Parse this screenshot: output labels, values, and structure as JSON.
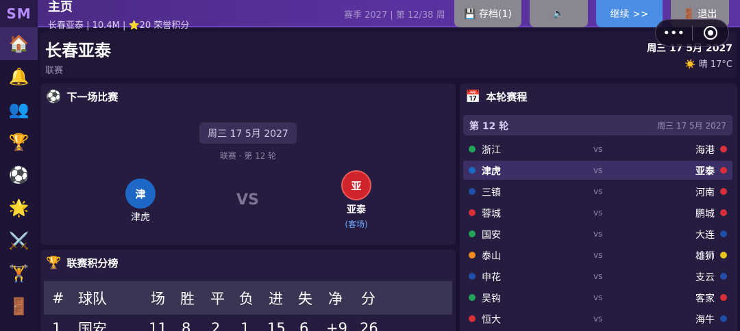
{
  "app": {
    "logo": "SM"
  },
  "topbar": {
    "title": "主页",
    "subtitle": "长春亚泰 | 10.4M | ",
    "star": "⭐",
    "honor": "20 荣誉积分",
    "season": "赛季 2027 | 第 12/38 周",
    "save_label": "💾 存档(1)",
    "volume_label": "🔈",
    "continue_label": "继续  >>",
    "exit_label": "🚪 退出"
  },
  "capsule": {
    "more_label": "•••"
  },
  "sidebar": {
    "items": [
      {
        "name": "home",
        "icon": "🏠"
      },
      {
        "name": "notifications",
        "icon": "🔔"
      },
      {
        "name": "squad",
        "icon": "👥"
      },
      {
        "name": "trophies",
        "icon": "🏆"
      },
      {
        "name": "matches",
        "icon": "⚽"
      },
      {
        "name": "highlights",
        "icon": "🌟"
      },
      {
        "name": "battle",
        "icon": "⚔️"
      },
      {
        "name": "training",
        "icon": "🏋️"
      },
      {
        "name": "exit",
        "icon": "🚪"
      }
    ]
  },
  "header": {
    "team": "长春亚泰",
    "competition": "联赛",
    "date": "周三 17 5月 2027",
    "weather_icon": "☀️",
    "weather": "晴 17°C"
  },
  "next_match": {
    "title": "下一场比赛",
    "icon": "⚽",
    "date": "周三 17 5月 2027",
    "info": "联赛  ·  第 12 轮",
    "home_crest": "津",
    "home_name": "津虎",
    "vs": "VS",
    "away_crest": "亚",
    "away_name": "亚泰",
    "away_note": "(客场)"
  },
  "league_table": {
    "title": "联赛积分榜",
    "icon": "🏆",
    "headers": [
      "#",
      "球队",
      "场",
      "胜",
      "平",
      "负",
      "进",
      "失",
      "净",
      "分"
    ],
    "rows": [
      [
        "1",
        "国安",
        "11",
        "8",
        "2",
        "1",
        "15",
        "6",
        "+9",
        "26"
      ]
    ]
  },
  "round": {
    "title": "本轮赛程",
    "icon": "📅",
    "round_label": "第 12 轮",
    "round_date": "周三 17 5月 2027",
    "vs": "vs",
    "matches": [
      {
        "home": "浙江",
        "away": "海港",
        "home_color": "#22a35a",
        "away_color": "#d8303a",
        "highlight": false
      },
      {
        "home": "津虎",
        "away": "亚泰",
        "home_color": "#1f67c4",
        "away_color": "#d8303a",
        "highlight": true
      },
      {
        "home": "三镇",
        "away": "河南",
        "home_color": "#1f4fa8",
        "away_color": "#d8303a",
        "highlight": false
      },
      {
        "home": "蓉城",
        "away": "鹏城",
        "home_color": "#d8303a",
        "away_color": "#d8303a",
        "highlight": false
      },
      {
        "home": "国安",
        "away": "大连",
        "home_color": "#22a35a",
        "away_color": "#1f4fa8",
        "highlight": false
      },
      {
        "home": "泰山",
        "away": "雄狮",
        "home_color": "#f08a1c",
        "away_color": "#e3c21d",
        "highlight": false
      },
      {
        "home": "申花",
        "away": "支云",
        "home_color": "#1f4fa8",
        "away_color": "#1f4fa8",
        "highlight": false
      },
      {
        "home": "吴钩",
        "away": "客家",
        "home_color": "#22a35a",
        "away_color": "#d8303a",
        "highlight": false
      },
      {
        "home": "恒大",
        "away": "海牛",
        "home_color": "#d8303a",
        "away_color": "#1f4fa8",
        "highlight": false
      }
    ]
  }
}
